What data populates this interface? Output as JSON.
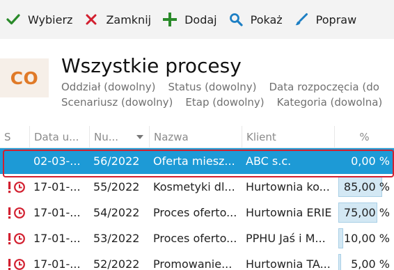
{
  "toolbar": {
    "buttons": [
      {
        "label": "Wybierz",
        "icon": "checkmark-icon",
        "color": "#2a8a2a"
      },
      {
        "label": "Zamknij",
        "icon": "close-icon",
        "color": "#d21f2f"
      },
      {
        "label": "Dodaj",
        "icon": "plus-icon",
        "color": "#2a8a2a"
      },
      {
        "label": "Pokaż",
        "icon": "search-icon",
        "color": "#1d7fc4"
      },
      {
        "label": "Popraw",
        "icon": "brush-icon",
        "color": "#1d7fc4"
      }
    ]
  },
  "header": {
    "logo": "CO",
    "logo_color": "#e07a28",
    "title": "Wszystkie procesy",
    "filters_row1": [
      "Oddział (dowolny)",
      "Status (dowolny)",
      "Data rozpoczęcia (do"
    ],
    "filters_row2": [
      "Scenariusz (dowolny)",
      "Etap (dowolny)",
      "Kategoria (dowolna)"
    ]
  },
  "grid": {
    "columns": [
      "S",
      "Data u...",
      "Nu...",
      "Nazwa",
      "Klient",
      "%"
    ],
    "sorted_column": "Nu...",
    "rows": [
      {
        "status_icon": "",
        "date": "02-03-...",
        "number": "56/2022",
        "name": "Oferta miesz...",
        "client": "ABC s.c.",
        "percent": "0,00 %",
        "progress": 0,
        "selected": true
      },
      {
        "status_icon": "alert-clock-icon",
        "date": "17-01-...",
        "number": "55/2022",
        "name": "Kosmetyki dl...",
        "client": "Hurtownia ko...",
        "percent": "85,00 %",
        "progress": 0.85,
        "selected": false
      },
      {
        "status_icon": "alert-clock-icon",
        "date": "17-01-...",
        "number": "54/2022",
        "name": "Proces oferto...",
        "client": "Hurtownia ERIE",
        "percent": "75,00 %",
        "progress": 0.75,
        "selected": false
      },
      {
        "status_icon": "alert-clock-icon",
        "date": "17-01-...",
        "number": "53/2022",
        "name": "Proces oferto...",
        "client": "PPHU Jaś i M...",
        "percent": "10,00 %",
        "progress": 0.1,
        "selected": false
      },
      {
        "status_icon": "alert-clock-icon",
        "date": "17-01-...",
        "number": "52/2022",
        "name": "Promowanie...",
        "client": "Hurtownia TA...",
        "percent": "5,00 %",
        "progress": 0.05,
        "selected": false
      }
    ],
    "selection_color": "#1d9ad6",
    "alert_color": "#d21f2f"
  }
}
